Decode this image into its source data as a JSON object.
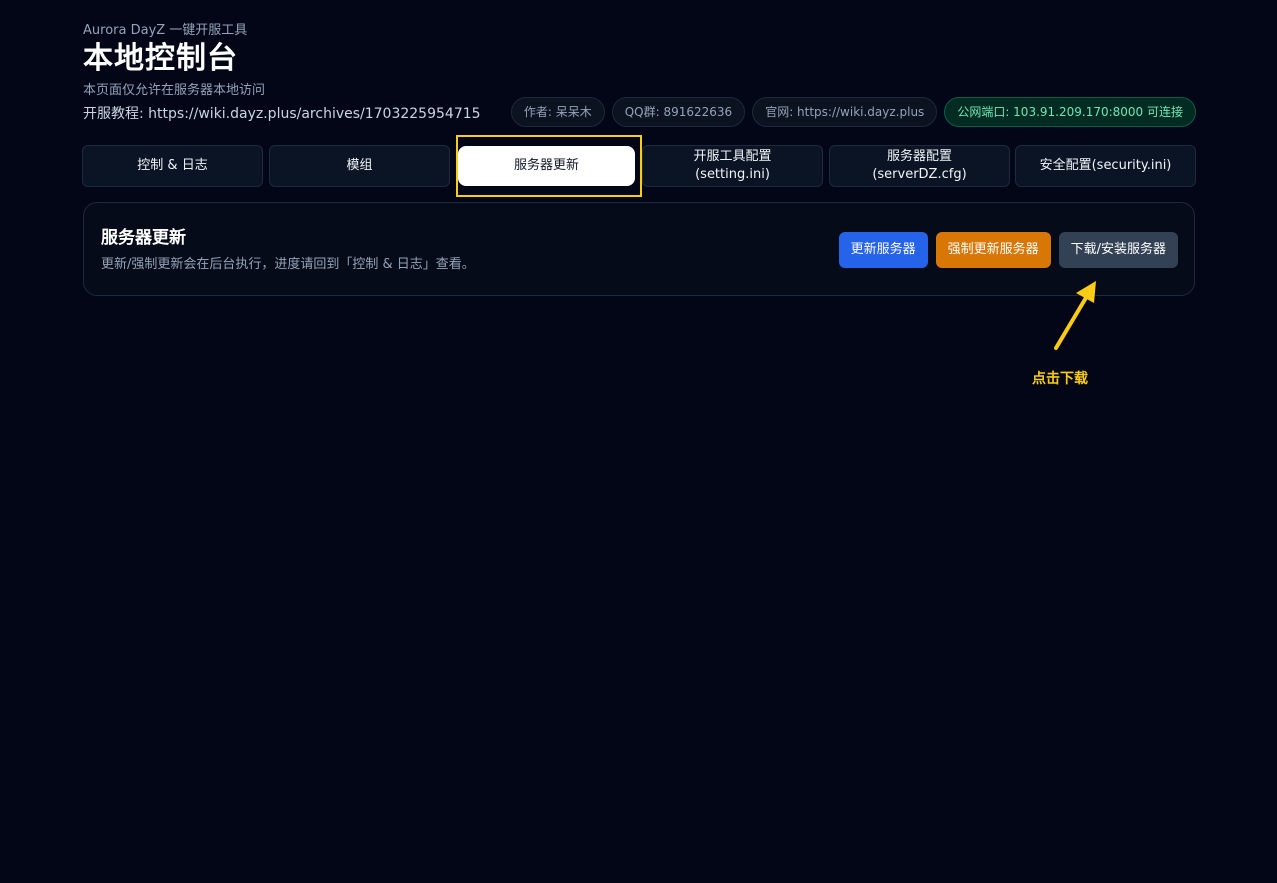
{
  "header": {
    "brand": "Aurora DayZ 一键开服工具",
    "title": "本地控制台",
    "note": "本页面仅允许在服务器本地访问",
    "tutorial": "开服教程: https://wiki.dayz.plus/archives/1703225954715"
  },
  "pills": {
    "author": "作者: 呆呆木",
    "qq": "QQ群: 891622636",
    "website": "官网: https://wiki.dayz.plus",
    "public_port": "公网端口: 103.91.209.170:8000 可连接"
  },
  "tabs": [
    {
      "line1": "控制 & 日志",
      "line2": ""
    },
    {
      "line1": "模组",
      "line2": ""
    },
    {
      "line1": "服务器更新",
      "line2": ""
    },
    {
      "line1": "开服工具配置",
      "line2": "(setting.ini)"
    },
    {
      "line1": "服务器配置",
      "line2": "(serverDZ.cfg)"
    },
    {
      "line1": "安全配置(security.ini)",
      "line2": ""
    }
  ],
  "active_tab": 2,
  "panel": {
    "title": "服务器更新",
    "description": "更新/强制更新会在后台执行，进度请回到「控制 & 日志」查看。",
    "update_button": "更新服务器",
    "force_update_button": "强制更新服务器",
    "download_button": "下载/安装服务器"
  },
  "annotation": {
    "text": "点击下载",
    "color": "#facc15"
  },
  "colors": {
    "background": "#020617",
    "blue_button": "#2563eb",
    "orange_button": "#d97706",
    "slate_button": "#334155",
    "status_green": "#6ee7b7"
  }
}
